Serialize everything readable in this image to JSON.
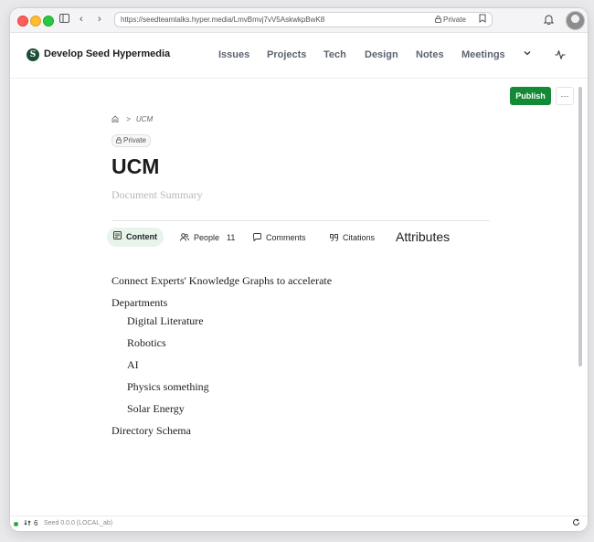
{
  "browser": {
    "url": "https://seedteamtalks.hyper.media/LmvBmvj7vV5AskwkpBwK8",
    "privacy_label": "Private"
  },
  "site": {
    "title": "Develop Seed Hypermedia",
    "logo_letter": "S",
    "nav": [
      "Issues",
      "Projects",
      "Tech",
      "Design",
      "Notes",
      "Meetings"
    ]
  },
  "toolbar": {
    "publish_label": "Publish",
    "more_label": "···"
  },
  "document": {
    "breadcrumb_current": "UCM",
    "privacy_badge": "Private",
    "title": "UCM",
    "summary_placeholder": "Document Summary",
    "tabs": {
      "content": "Content",
      "people": "People",
      "people_count": "11",
      "comments": "Comments",
      "citations": "Citations"
    },
    "attributes_label": "Attributes",
    "blocks": {
      "intro": "Connect Experts' Knowledge Graphs to accelerate",
      "departments": "Departments",
      "items": [
        "Digital Literature",
        "Robotics",
        "AI",
        "Physics something",
        "Solar Energy"
      ],
      "directory": "Directory Schema"
    }
  },
  "status": {
    "sync_count": "6",
    "version": "Seed 0.0.0 (LOCAL_ab)"
  },
  "colors": {
    "accent": "#138a36",
    "active_tab_bg": "#e7f4ea",
    "status_dot": "#28a745"
  }
}
